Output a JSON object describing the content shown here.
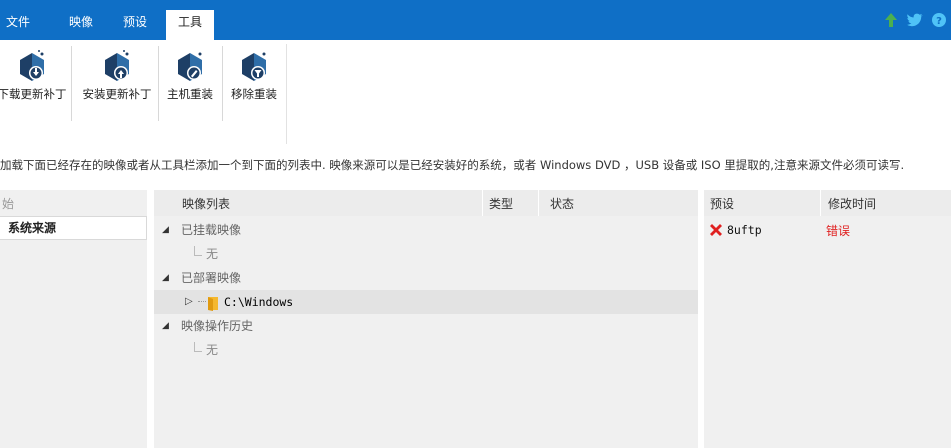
{
  "menu": {
    "tabs": [
      {
        "label": "文件"
      },
      {
        "label": "映像"
      },
      {
        "label": "预设"
      },
      {
        "label": "工具",
        "active": true
      }
    ]
  },
  "top_icons": [
    "arrow-up-icon",
    "twitter-icon",
    "help-icon"
  ],
  "colors": {
    "accent": "#0f6fc6",
    "error": "#e02020",
    "panel": "#f0f0f0"
  },
  "ribbon": {
    "buttons": [
      {
        "label": "下载更新补丁",
        "icon": "download-update-icon"
      },
      {
        "label": "安装更新补丁",
        "icon": "install-update-icon"
      },
      {
        "label": "主机重装",
        "icon": "host-reinstall-icon"
      },
      {
        "label": "移除重装",
        "icon": "remove-reinstall-icon"
      }
    ]
  },
  "hint": "加载下面已经存在的映像或者从工具栏添加一个到下面的列表中. 映像来源可以是已经安装好的系统，或者 Windows DVD ，USB 设备或 ISO 里提取的,注意来源文件必须可读写.",
  "left": {
    "header": "始",
    "item": "系统来源"
  },
  "image_list": {
    "columns": [
      "映像列表",
      "类型",
      "状态"
    ],
    "groups": [
      {
        "label": "已挂载映像",
        "children": [
          "无"
        ]
      },
      {
        "label": "已部署映像",
        "children": [
          "C:\\Windows"
        ]
      },
      {
        "label": "映像操作历史",
        "children": [
          "无"
        ]
      }
    ]
  },
  "presets": {
    "columns": [
      "预设",
      "修改时间"
    ],
    "rows": [
      {
        "name": "8uftp",
        "status": "错误",
        "icon": "error-x-icon"
      }
    ]
  }
}
